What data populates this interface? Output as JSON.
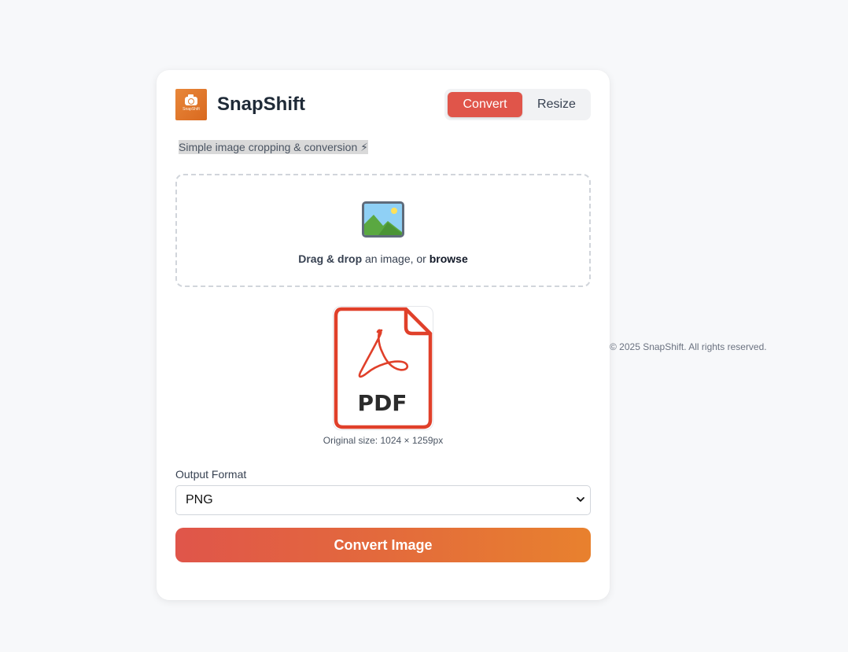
{
  "app": {
    "name": "SnapShift",
    "logo_text": "SnapShift",
    "tagline": "Simple image cropping & conversion ⚡"
  },
  "tabs": [
    {
      "label": "Convert",
      "active": true
    },
    {
      "label": "Resize",
      "active": false
    }
  ],
  "dropzone": {
    "icon": "image-icon",
    "text_strong": "Drag & drop",
    "text_middle": " an image, or ",
    "text_link": "browse"
  },
  "preview": {
    "icon": "pdf-file-icon",
    "file_label": "PDF",
    "original_size": "Original size: 1024 × 1259px"
  },
  "output_format": {
    "label": "Output Format",
    "selected": "PNG"
  },
  "actions": {
    "convert_label": "Convert Image"
  },
  "footer": {
    "copyright": "© 2025 SnapShift. All rights reserved."
  },
  "colors": {
    "accent": "#e0554a",
    "accent_end": "#e8812e",
    "pdf_red": "#e0402a",
    "background": "#f7f8fa"
  }
}
